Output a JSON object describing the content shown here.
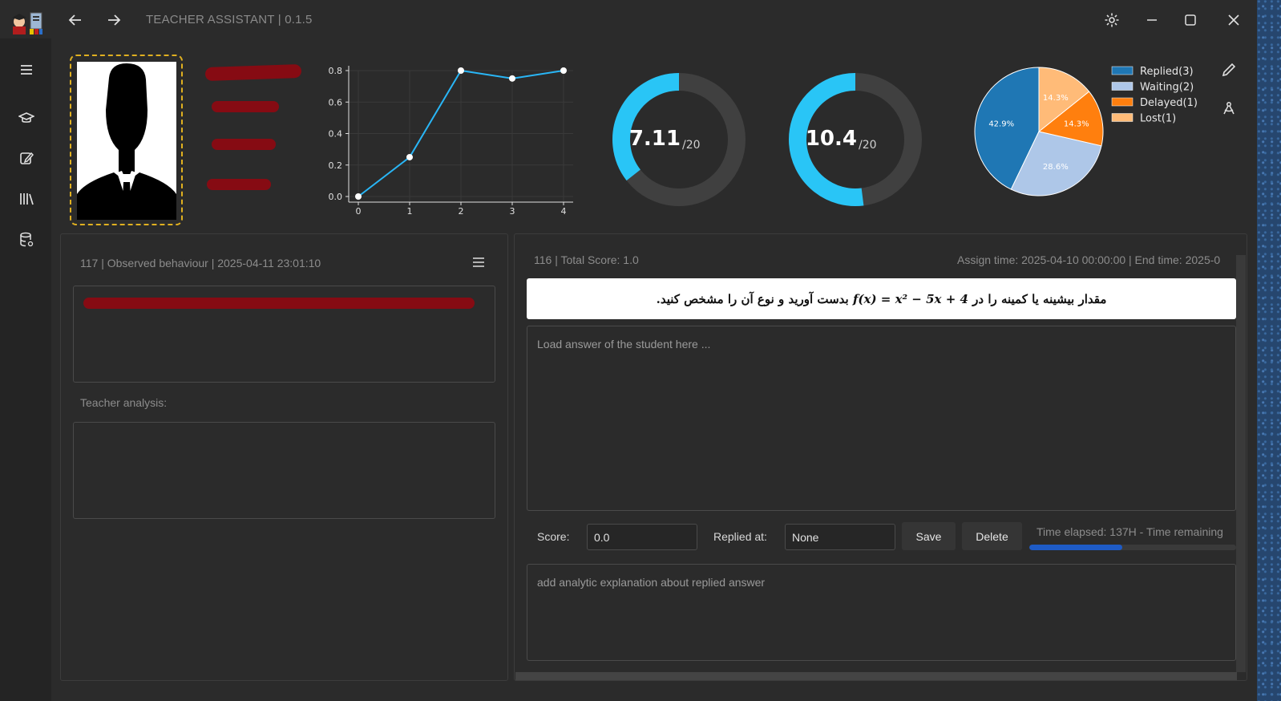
{
  "app": {
    "title": "TEACHER ASSISTANT | 0.1.5"
  },
  "line_chart": {
    "type": "line",
    "x": [
      0,
      1,
      2,
      3,
      4
    ],
    "values": [
      0.0,
      0.25,
      0.8,
      0.75,
      0.8
    ],
    "ylim": [
      0.0,
      0.8
    ],
    "yticks": [
      "0.0",
      "0.2",
      "0.4",
      "0.6",
      "0.8"
    ],
    "xticks": [
      "0",
      "1",
      "2",
      "3",
      "4"
    ],
    "color": "#29b6f6"
  },
  "donuts": [
    {
      "value_label": "7.11",
      "suffix": "/20",
      "value": 7.11,
      "max": 20
    },
    {
      "value_label": "10.4",
      "suffix": "/20",
      "value": 10.4,
      "max": 20
    }
  ],
  "chart_data": {
    "type": "pie",
    "slices": [
      {
        "label": "Replied(3)",
        "value": 42.9,
        "pct_label": "42.9%",
        "color": "#1f77b4"
      },
      {
        "label": "Waiting(2)",
        "value": 28.6,
        "pct_label": "28.6%",
        "color": "#aec7e8"
      },
      {
        "label": "Delayed(1)",
        "value": 14.3,
        "pct_label": "14.3%",
        "color": "#ff7f0e"
      },
      {
        "label": "Lost(1)",
        "value": 14.3,
        "pct_label": "14.3%",
        "color": "#ffbb78"
      }
    ],
    "legend": "right"
  },
  "left_panel": {
    "header": "117 | Observed behaviour | 2025-04-11 23:01:10",
    "teacher_label": "Teacher analysis:"
  },
  "right_panel": {
    "header_left": "116 | Total Score: 1.0",
    "header_right": "Assign time: 2025-04-10 00:00:00 | End time: 2025-0",
    "question_prefix": "مقدار بیشینه یا کمینه را در",
    "question_formula": "f(x) = x² − 5x + 4",
    "question_suffix": "بدست آورید و نوع آن را مشخص کنید.",
    "answer_placeholder": "Load answer of the student here ...",
    "score_label": "Score:",
    "score_value": "0.0",
    "replied_label": "Replied at:",
    "replied_value": "None",
    "save_label": "Save",
    "delete_label": "Delete",
    "time_text": "Time elapsed: 137H - Time remaining",
    "progress": 0.45,
    "analysis_placeholder": "add analytic explanation about replied answer"
  }
}
